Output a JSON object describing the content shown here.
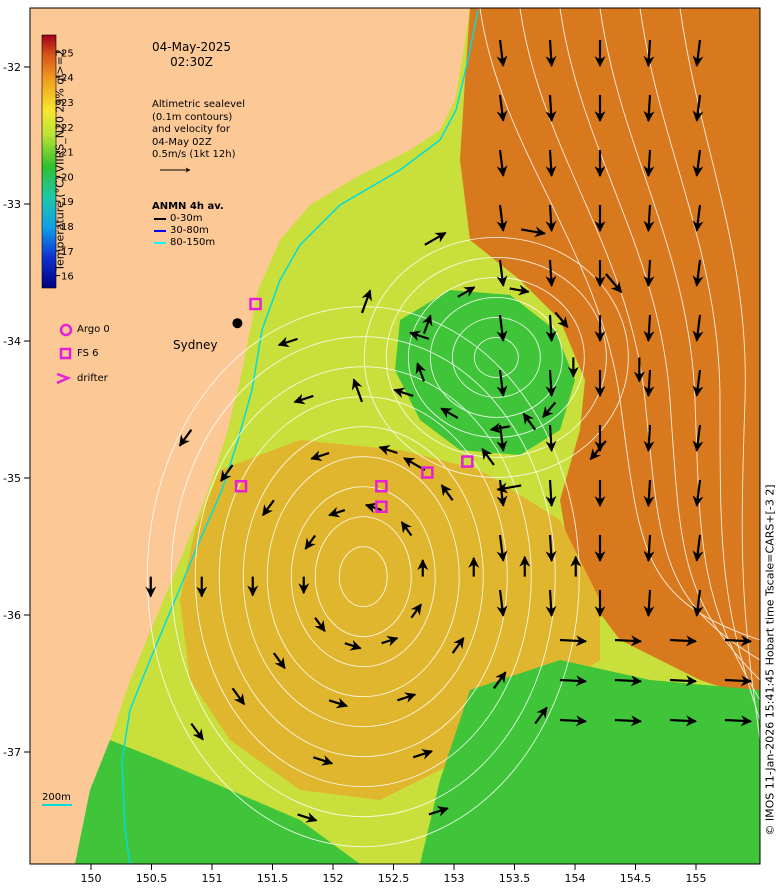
{
  "header": {
    "date": "04-May-2025",
    "time": "02:30Z"
  },
  "altimetry_note": {
    "lines": [
      "Altimetric sealevel",
      "(0.1m contours)",
      "and velocity for",
      "04-May 02Z",
      "0.5m/s (1kt 12h)"
    ]
  },
  "anmn_legend": {
    "title": "ANMN 4h av.",
    "items": [
      {
        "label": "0-30m",
        "color": "#000000"
      },
      {
        "label": "30-80m",
        "color": "#0000ff"
      },
      {
        "label": "80-150m",
        "color": "#00ffff"
      }
    ]
  },
  "colorbar": {
    "label": "Temperature (°C) VIIRS_N20 29% ql>=2",
    "ticks": [
      "25",
      "24",
      "23",
      "22",
      "21",
      "20",
      "19",
      "18",
      "17",
      "16"
    ],
    "min": 15.5,
    "max": 25.7
  },
  "legend": {
    "argo": "Argo 0",
    "fs": "FS 6",
    "drifter": "drifter"
  },
  "labels": {
    "sydney": "Sydney",
    "scale": "200m"
  },
  "credit": "© IMOS 11-Jan-2026 15:41:45 Hobart time Tscale=CARS+[-3 2]",
  "axes": {
    "lat_ticks": [
      "-32",
      "-33",
      "-34",
      "-35",
      "-36",
      "-37"
    ],
    "lon_ticks": [
      "150",
      "150.5",
      "151",
      "151.5",
      "152",
      "152.5",
      "153",
      "153.5",
      "154",
      "154.5",
      "155"
    ]
  },
  "colors": {
    "land": "#fcc896",
    "warm_current": "#d9791e",
    "eddy_core": "#e0b62e",
    "shelf": "#c9e03c",
    "cool_eddy": "#3fc43a",
    "magenta": "#e51fd5",
    "cyan": "#00dcdc"
  },
  "map_data": {
    "fs_markers": [
      {
        "lon": 151.36,
        "lat": -33.73
      },
      {
        "lon": 151.24,
        "lat": -35.06
      },
      {
        "lon": 152.4,
        "lat": -35.06
      },
      {
        "lon": 152.4,
        "lat": -35.21
      },
      {
        "lon": 152.78,
        "lat": -34.96
      },
      {
        "lon": 153.11,
        "lat": -34.88
      }
    ],
    "city": {
      "lon": 151.21,
      "lat": -33.87
    },
    "eddies": [
      {
        "lon": 152.25,
        "lat": -35.72,
        "kind": "anticyclone"
      },
      {
        "lon": 153.35,
        "lat": -34.12,
        "kind": "cyclone"
      }
    ]
  }
}
